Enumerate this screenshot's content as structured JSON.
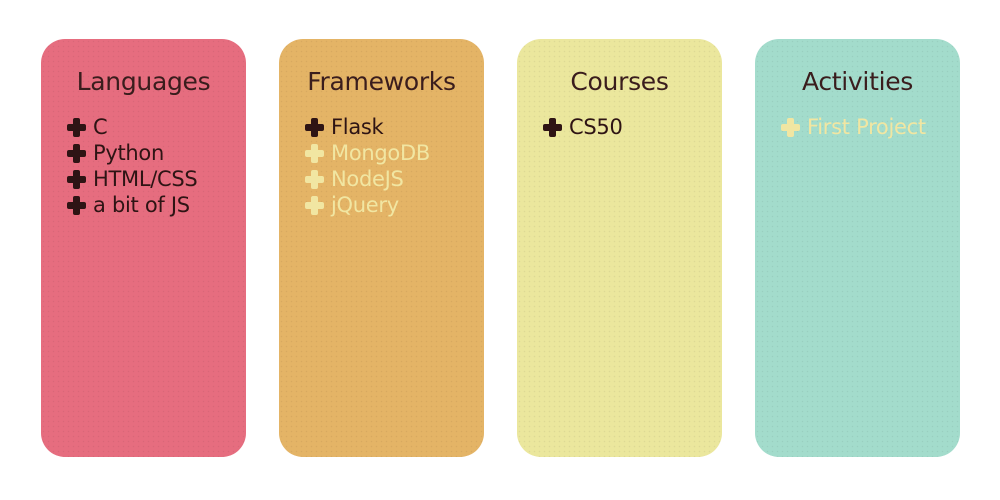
{
  "colors": {
    "languages_card": "#e66d7f",
    "frameworks_card": "#e4b466",
    "courses_card": "#ebe79d",
    "activities_card": "#a3dccc",
    "done_text": "#2e1414",
    "todo_text": "#f1e6a2",
    "title_text": "#3a1d1d"
  },
  "cards": [
    {
      "title": "Languages",
      "items": [
        {
          "label": "C",
          "icon": "plus-icon",
          "status": "done"
        },
        {
          "label": "Python",
          "icon": "plus-icon",
          "status": "done"
        },
        {
          "label": "HTML/CSS",
          "icon": "plus-icon",
          "status": "done"
        },
        {
          "label": "a bit of JS",
          "icon": "plus-icon",
          "status": "done"
        }
      ]
    },
    {
      "title": "Frameworks",
      "items": [
        {
          "label": "Flask",
          "icon": "plus-icon",
          "status": "done"
        },
        {
          "label": "MongoDB",
          "icon": "plus-icon",
          "status": "todo"
        },
        {
          "label": "NodeJS",
          "icon": "plus-icon",
          "status": "todo"
        },
        {
          "label": "jQuery",
          "icon": "plus-icon",
          "status": "todo"
        }
      ]
    },
    {
      "title": "Courses",
      "items": [
        {
          "label": "CS50",
          "icon": "plus-icon",
          "status": "done"
        }
      ]
    },
    {
      "title": "Activities",
      "items": [
        {
          "label": "First Project",
          "icon": "plus-icon",
          "status": "todo"
        }
      ]
    }
  ]
}
